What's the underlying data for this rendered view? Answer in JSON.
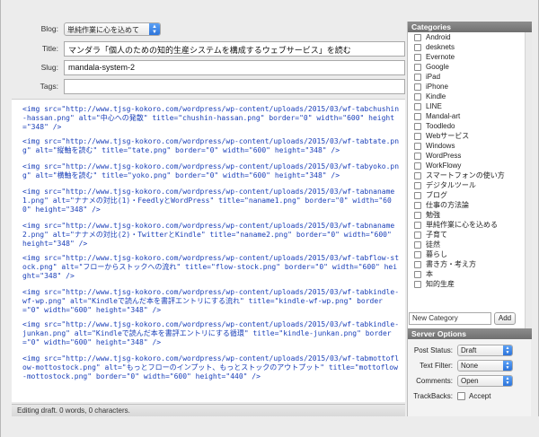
{
  "meta": {
    "blog_label": "Blog:",
    "blog_value": "単純作業に心を込めて",
    "title_label": "Title:",
    "title_value": "マンダラ「個人のための知的生産システムを構成するウェブサービス」を読む",
    "slug_label": "Slug:",
    "slug_value": "mandala-system-2",
    "tags_label": "Tags:",
    "tags_value": ""
  },
  "editor": {
    "blocks": [
      "<img src=\"http://www.tjsg-kokoro.com/wordpress/wp-content/uploads/2015/03/wf-tabchushin-hassan.png\" alt=\"中心への発散\" title=\"chushin-hassan.png\" border=\"0\" width=\"600\" height=\"348\" />",
      "<img src=\"http://www.tjsg-kokoro.com/wordpress/wp-content/uploads/2015/03/wf-tabtate.png\" alt=\"縦軸を読む\" title=\"tate.png\" border=\"0\" width=\"600\" height=\"348\" />",
      "<img src=\"http://www.tjsg-kokoro.com/wordpress/wp-content/uploads/2015/03/wf-tabyoko.png\" alt=\"横軸を読む\" title=\"yoko.png\" border=\"0\" width=\"600\" height=\"348\" />",
      "<img src=\"http://www.tjsg-kokoro.com/wordpress/wp-content/uploads/2015/03/wf-tabnaname1.png\" alt=\"ナナメの対比(1)・FeedlyとWordPress\" title=\"naname1.png\" border=\"0\" width=\"600\" height=\"348\" />",
      "<img src=\"http://www.tjsg-kokoro.com/wordpress/wp-content/uploads/2015/03/wf-tabnaname2.png\" alt=\"ナナメの対比(2)・TwitterとKindle\" title=\"naname2.png\" border=\"0\" width=\"600\" height=\"348\" />",
      "<img src=\"http://www.tjsg-kokoro.com/wordpress/wp-content/uploads/2015/03/wf-tabflow-stock.png\" alt=\"フローからストックへの流れ\" title=\"flow-stock.png\" border=\"0\" width=\"600\" height=\"348\" />",
      "<img src=\"http://www.tjsg-kokoro.com/wordpress/wp-content/uploads/2015/03/wf-tabkindle-wf-wp.png\" alt=\"Kindleで読んだ本を書評エントリにする流れ\" title=\"kindle-wf-wp.png\" border=\"0\" width=\"600\" height=\"348\" />",
      "<img src=\"http://www.tjsg-kokoro.com/wordpress/wp-content/uploads/2015/03/wf-tabkindle-junkan.png\" alt=\"Kindleで読んだ本を書評エントリにする循環\" title=\"kindle-junkan.png\" border=\"0\" width=\"600\" height=\"348\" />",
      "<img src=\"http://www.tjsg-kokoro.com/wordpress/wp-content/uploads/2015/03/wf-tabmottoflow-mottostock.png\" alt=\"もっとフローのインプット、もっとストックのアウトプット\" title=\"mottoflow-mottostock.png\" border=\"0\" width=\"600\" height=\"440\" />"
    ]
  },
  "status": {
    "text": "Editing draft. 0 words, 0 characters."
  },
  "categories": {
    "header": "Categories",
    "items": [
      "Android",
      "desknets",
      "Evernote",
      "Google",
      "iPad",
      "iPhone",
      "Kindle",
      "LINE",
      "Mandal-art",
      "Toodledo",
      "Webサービス",
      "Windows",
      "WordPress",
      "WorkFlowy",
      "スマートフォンの使い方",
      "デジタルツール",
      "ブログ",
      "仕事の方法論",
      "勉強",
      "単純作業に心を込める",
      "子育て",
      "徒然",
      "暮らし",
      "書き方・考え方",
      "本",
      "知的生産"
    ],
    "new_placeholder": "New Category",
    "add_label": "Add"
  },
  "server": {
    "header": "Server Options",
    "post_status_label": "Post Status:",
    "post_status_value": "Draft",
    "text_filter_label": "Text Filter:",
    "text_filter_value": "None",
    "comments_label": "Comments:",
    "comments_value": "Open",
    "trackbacks_label": "TrackBacks:",
    "trackbacks_value": "Accept"
  }
}
